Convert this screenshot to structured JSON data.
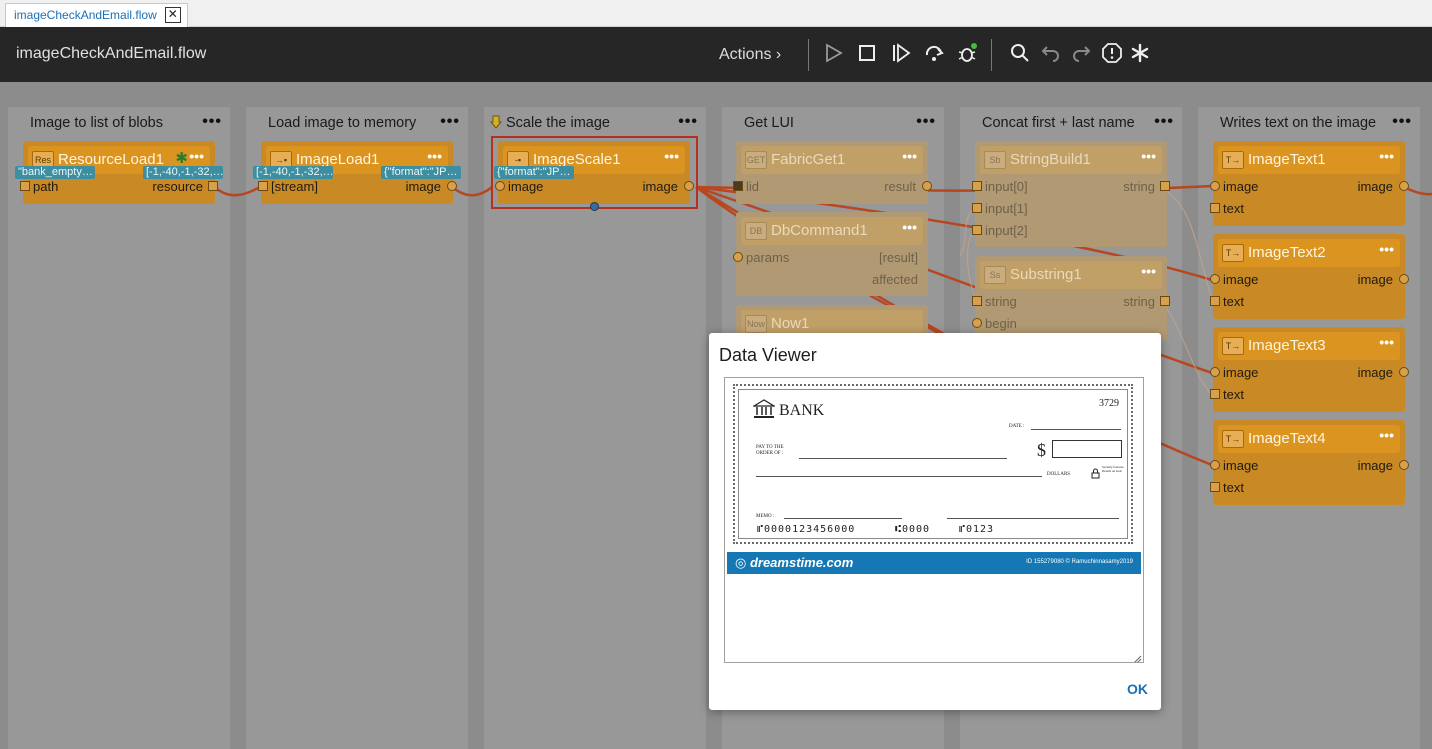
{
  "tab": {
    "label": "imageCheckAndEmail.flow",
    "close": "✕"
  },
  "header": {
    "title": "imageCheckAndEmail.flow",
    "actions_label": "Actions ›"
  },
  "lanes": [
    {
      "title": "Image to list of blobs",
      "dots": "•••"
    },
    {
      "title": "Load image to memory",
      "dots": "•••"
    },
    {
      "title": "Scale the image",
      "dots": "•••"
    },
    {
      "title": "Get LUI",
      "dots": "•••"
    },
    {
      "title": "Concat first + last name",
      "dots": "•••"
    },
    {
      "title": "Writes text on the image",
      "dots": "•••"
    }
  ],
  "nodes": {
    "resourceload1": {
      "badge": "Res",
      "title": "ResourceLoad1",
      "dots": "•••",
      "star": "✱",
      "chip_in": "\"bank_empty…",
      "chip_out": "[-1,-40,-1,-32,…",
      "port_in": "path",
      "port_out": "resource"
    },
    "imageload1": {
      "badge": "→▪",
      "title": "ImageLoad1",
      "dots": "•••",
      "chip_in": "[-1,-40,-1,-32,…",
      "chip_out": "{\"format\":\"JP…",
      "port_in": "[stream]",
      "port_out": "image"
    },
    "imagescale1": {
      "badge": "-▪",
      "title": "ImageScale1",
      "dots": "•••",
      "chip_in": "{\"format\":\"JP…",
      "port_in": "image",
      "port_out": "image"
    },
    "fabricget1": {
      "badge": "GET",
      "title": "FabricGet1",
      "dots": "•••",
      "port_in": "lid",
      "port_out": "result"
    },
    "dbcommand1": {
      "badge": "DB",
      "title": "DbCommand1",
      "dots": "•••",
      "port_in": "params",
      "port_out": "[result]",
      "port_out2": "affected"
    },
    "now1": {
      "badge": "Now",
      "title": "Now1"
    },
    "stringbuild1": {
      "badge": "Sb",
      "title": "StringBuild1",
      "dots": "•••",
      "port_in": "input[0]",
      "port_in2": "input[1]",
      "port_in3": "input[2]",
      "port_out": "string"
    },
    "substring1": {
      "badge": "Ss",
      "title": "Substring1",
      "dots": "•••",
      "port_in": "string",
      "port_in2": "begin",
      "port_out": "string"
    },
    "imagetext1": {
      "badge": "T→",
      "title": "ImageText1",
      "dots": "•••",
      "port_in": "image",
      "port_in2": "text",
      "port_out": "image"
    },
    "imagetext2": {
      "badge": "T→",
      "title": "ImageText2",
      "dots": "•••",
      "port_in": "image",
      "port_in2": "text",
      "port_out": "image"
    },
    "imagetext3": {
      "badge": "T→",
      "title": "ImageText3",
      "dots": "•••",
      "port_in": "image",
      "port_in2": "text",
      "port_out": "image"
    },
    "imagetext4": {
      "badge": "T→",
      "title": "ImageText4",
      "dots": "•••",
      "port_in": "image",
      "port_in2": "text",
      "port_out": "image"
    }
  },
  "dialog": {
    "title": "Data Viewer",
    "ok": "OK",
    "cheque": {
      "bank": "BANK",
      "number": "3729",
      "date_label": "DATE :",
      "pay_to": "PAY TO THE",
      "order_of": "ORDER OF :",
      "dollar_sign": "$",
      "dollars": "DOLLARS",
      "security": "Security features Details on back",
      "memo": "MEMO :",
      "micr1": "⑈0000123456000",
      "micr2": "⑆0000",
      "micr3": "⑈0123"
    },
    "band": {
      "logo": "◎ dreamstime.com",
      "id": "ID 155279080 © Ramuchinnasamy2019"
    }
  }
}
